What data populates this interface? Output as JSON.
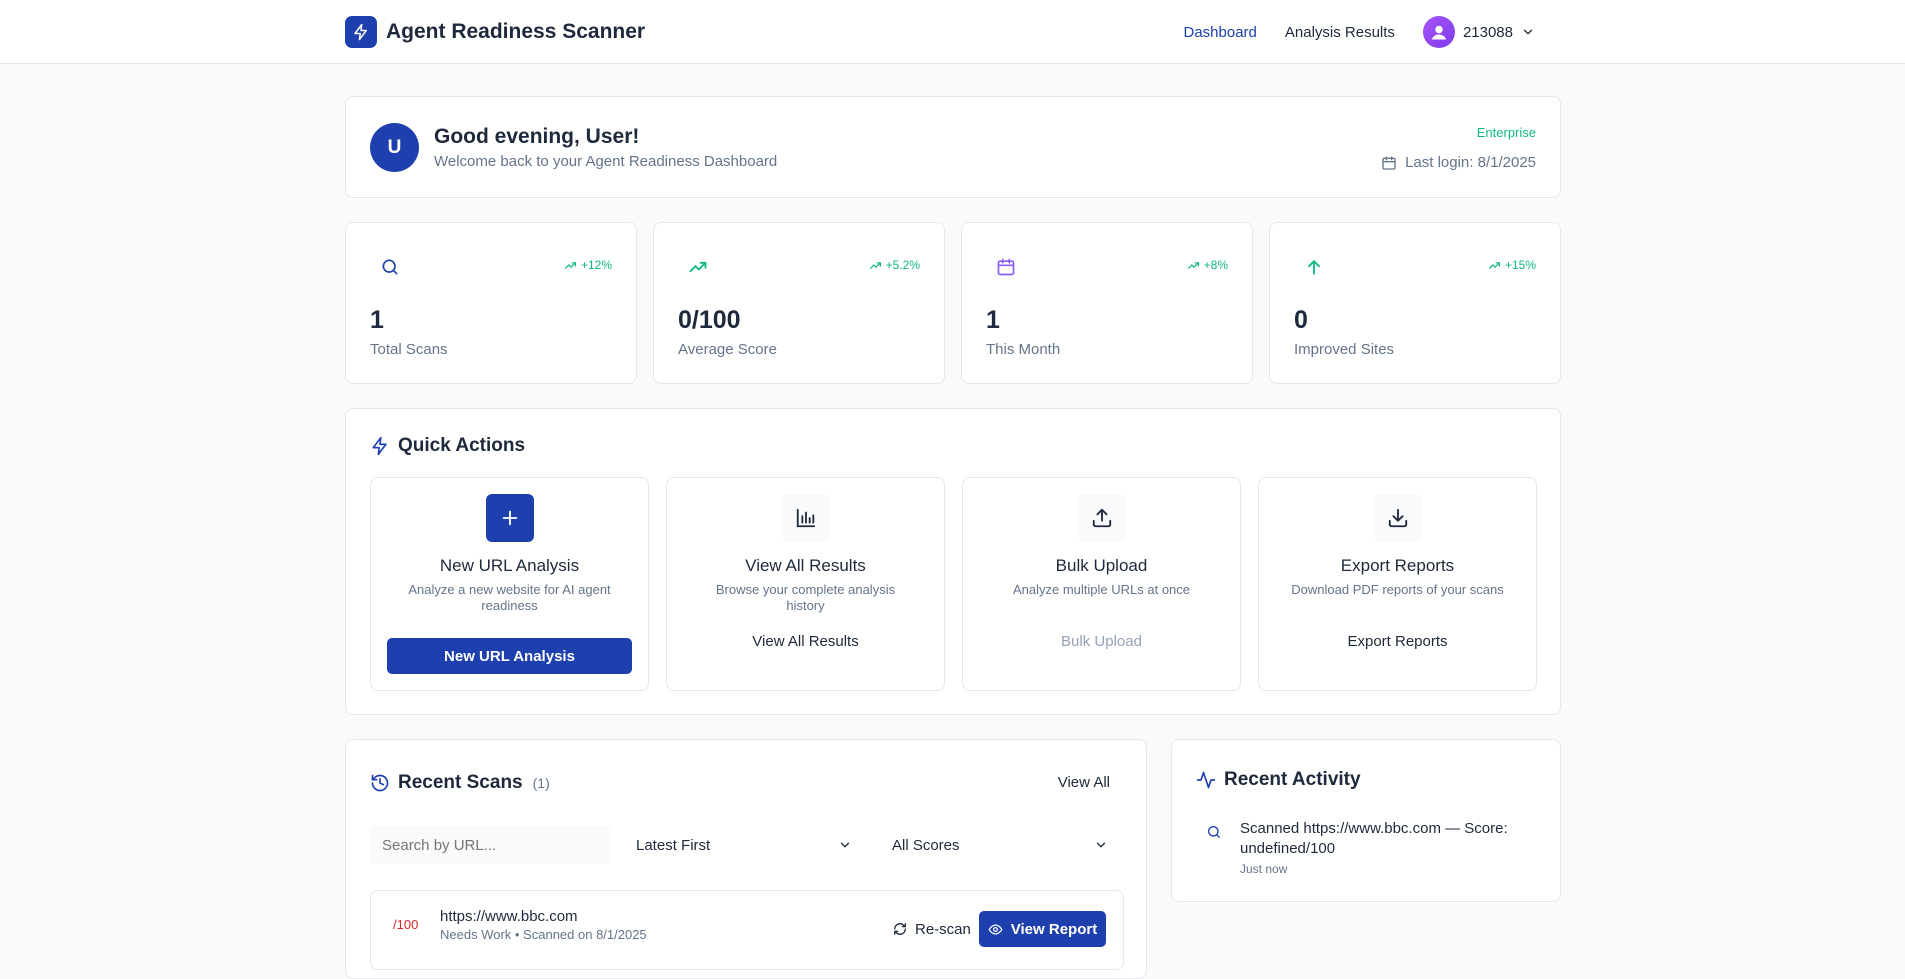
{
  "app": {
    "title": "Agent Readiness Scanner"
  },
  "nav": {
    "items": [
      {
        "label": "Dashboard",
        "active": true
      },
      {
        "label": "Analysis Results",
        "active": false
      }
    ],
    "user": {
      "name": "213088"
    }
  },
  "welcome": {
    "avatar_initial": "U",
    "greeting": "Good evening, User!",
    "subtitle": "Welcome back to your Agent Readiness Dashboard",
    "plan": "Enterprise",
    "last_login": "Last login: 8/1/2025"
  },
  "stats": [
    {
      "icon": "search-icon",
      "trend": "+12%",
      "value": "1",
      "label": "Total Scans"
    },
    {
      "icon": "trending-up-icon",
      "trend": "+5.2%",
      "value": "0/100",
      "label": "Average Score"
    },
    {
      "icon": "calendar-icon",
      "trend": "+8%",
      "value": "1",
      "label": "This Month"
    },
    {
      "icon": "arrow-up-icon",
      "trend": "+15%",
      "value": "0",
      "label": "Improved Sites"
    }
  ],
  "quick_actions": {
    "title": "Quick Actions",
    "items": [
      {
        "icon": "plus-icon",
        "title": "New URL Analysis",
        "description": "Analyze a new website for AI agent readiness",
        "button": "New URL Analysis"
      },
      {
        "icon": "bar-chart-icon",
        "title": "View All Results",
        "description": "Browse your complete analysis history",
        "button": "View All Results"
      },
      {
        "icon": "upload-icon",
        "title": "Bulk Upload",
        "description": "Analyze multiple URLs at once",
        "button": "Bulk Upload"
      },
      {
        "icon": "download-icon",
        "title": "Export Reports",
        "description": "Download PDF reports of your scans",
        "button": "Export Reports"
      }
    ]
  },
  "recent_scans": {
    "title": "Recent Scans",
    "count": "(1)",
    "view_all": "View All",
    "search_placeholder": "Search by URL...",
    "sort_value": "Latest First",
    "filter_value": "All Scores",
    "rows": [
      {
        "score": "/100",
        "url": "https://www.bbc.com",
        "meta": "Needs Work • Scanned on 8/1/2025",
        "rescan": "Re-scan",
        "view": "View Report"
      }
    ]
  },
  "recent_activity": {
    "title": "Recent Activity",
    "items": [
      {
        "icon": "search-icon",
        "text": "Scanned https://www.bbc.com — Score: undefined/100",
        "time": "Just now"
      }
    ]
  },
  "colors": {
    "primary": "#1e40af",
    "success": "#10b981",
    "danger": "#dc2626",
    "muted": "#64748b",
    "background": "#f8fafc"
  }
}
